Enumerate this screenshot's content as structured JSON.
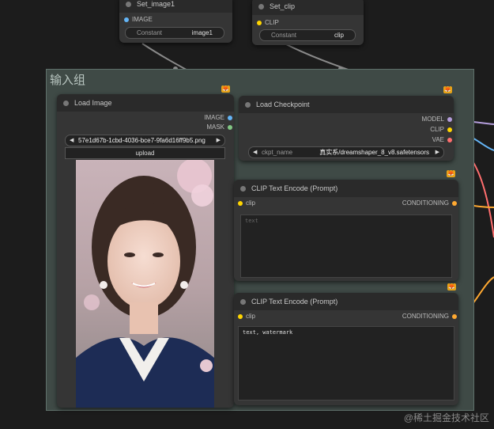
{
  "group": {
    "title": "输入组"
  },
  "set_image1": {
    "title": "Set_image1",
    "input": "IMAGE",
    "widget_label": "Constant",
    "widget_value": "image1"
  },
  "set_clip": {
    "title": "Set_clip",
    "input": "CLIP",
    "widget_label": "Constant",
    "widget_value": "clip"
  },
  "load_image": {
    "title": "Load Image",
    "outputs": [
      "IMAGE",
      "MASK"
    ],
    "file": "57e1d67b-1cbd-4036-bce7-9fa6d16ff9b5.png",
    "upload_label": "upload"
  },
  "load_checkpoint": {
    "title": "Load Checkpoint",
    "outputs": [
      "MODEL",
      "CLIP",
      "VAE"
    ],
    "widget_label": "ckpt_name",
    "widget_value": "真实系/dreamshaper_8_v8.safetensors"
  },
  "clip_encode_1": {
    "title": "CLIP Text Encode (Prompt)",
    "input": "clip",
    "output": "CONDITIONING",
    "text": "",
    "placeholder": "text"
  },
  "clip_encode_2": {
    "title": "CLIP Text Encode (Prompt)",
    "input": "clip",
    "output": "CONDITIONING",
    "text": "text, watermark"
  },
  "watermark": "@稀土掘金技术社区",
  "badge_glyph": "🦊",
  "colors": {
    "image": "#64b5f6",
    "mask": "#81c784",
    "model": "#b39ddb",
    "clip": "#ffd500",
    "vae": "#ff6e6e",
    "conditioning": "#ffa931",
    "group_bg": "#3f4a46",
    "group_border": "#5f716b"
  }
}
